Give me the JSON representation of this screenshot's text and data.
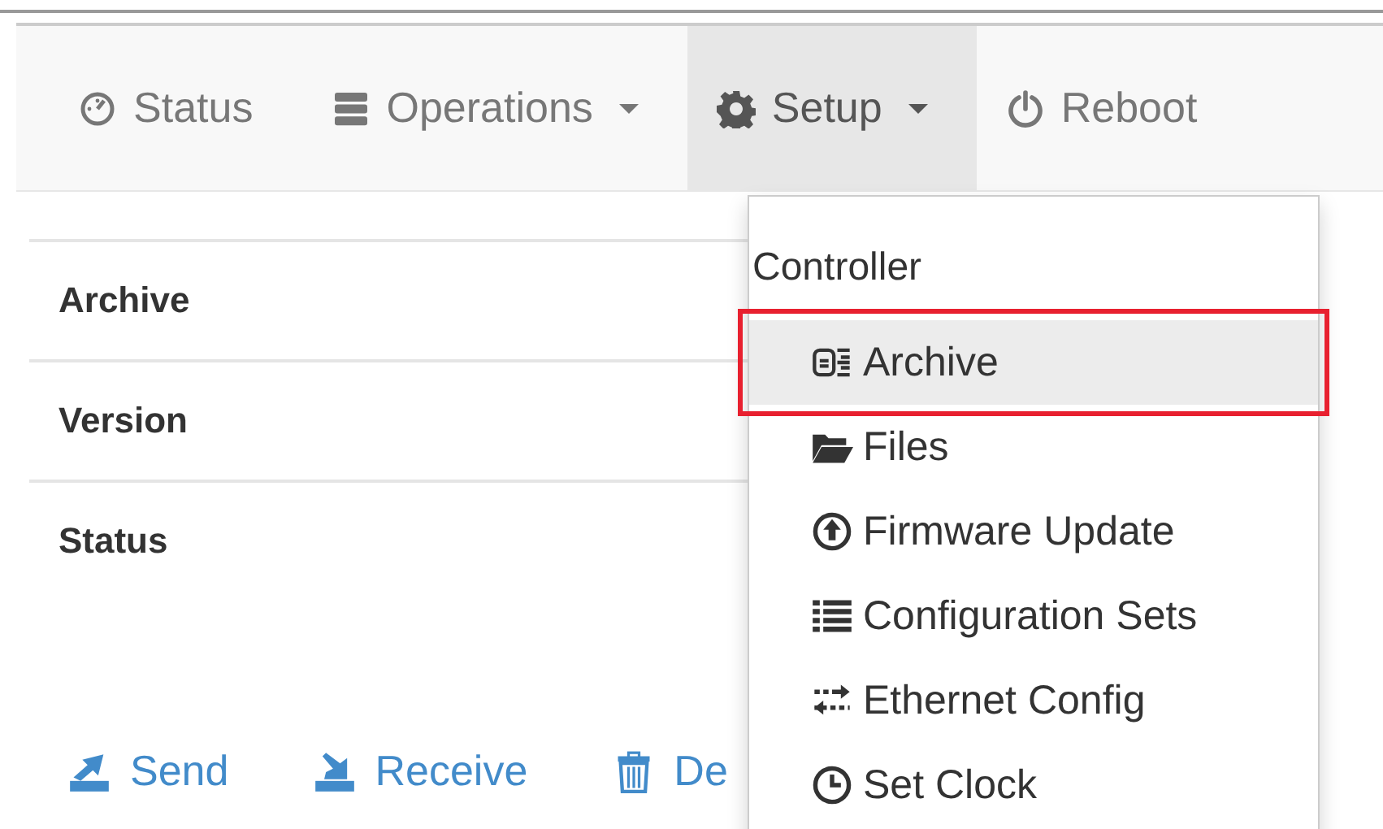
{
  "navbar": {
    "items": [
      {
        "label": "Status",
        "dropdown": false,
        "selected": false
      },
      {
        "label": "Operations",
        "dropdown": true,
        "selected": false
      },
      {
        "label": "Setup",
        "dropdown": true,
        "selected": true
      },
      {
        "label": "Reboot",
        "dropdown": false,
        "selected": false
      }
    ]
  },
  "details": {
    "rows": [
      {
        "label": "Archive"
      },
      {
        "label": "Version"
      },
      {
        "label": "Status"
      }
    ]
  },
  "actions": [
    {
      "label": "Send"
    },
    {
      "label": "Receive"
    },
    {
      "label": "De"
    }
  ],
  "setup_menu": {
    "header": "Controller",
    "items": [
      {
        "label": "Archive",
        "selected": true,
        "highlighted": true
      },
      {
        "label": "Files",
        "selected": false,
        "highlighted": false
      },
      {
        "label": "Firmware Update",
        "selected": false,
        "highlighted": false
      },
      {
        "label": "Configuration Sets",
        "selected": false,
        "highlighted": false
      },
      {
        "label": "Ethernet Config",
        "selected": false,
        "highlighted": false
      },
      {
        "label": "Set Clock",
        "selected": false,
        "highlighted": false
      }
    ]
  }
}
